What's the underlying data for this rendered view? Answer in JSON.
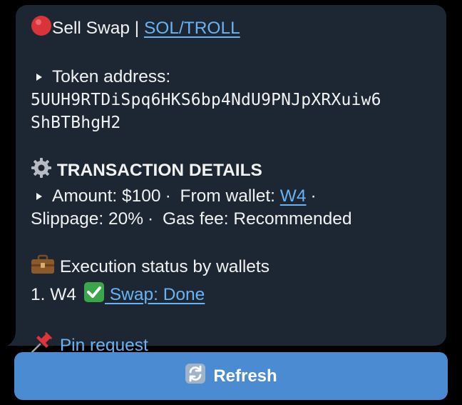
{
  "message": {
    "title_prefix": "Sell Swap | ",
    "pair_link": "SOL/TROLL",
    "token_label": "Token address:",
    "token_address_line1": "5UUH9RTDiSpq6HKS6bp4NdU9PNJpXRXuiw6",
    "token_address_line2": "ShBTBhgH2",
    "details_heading": "TRANSACTION DETAILS",
    "amount_text": "Amount: $100",
    "from_wallet_label": "From wallet: ",
    "from_wallet_link": "W4",
    "slippage_text": "Slippage: 20%",
    "gas_fee_text": "Gas fee: Recommended",
    "execution_heading": "Execution status by wallets",
    "execution_item_prefix": "1. W4",
    "execution_item_link": " Swap: Done",
    "pin_link": "Pin request",
    "separator": "·"
  },
  "button": {
    "refresh_label": "Refresh"
  },
  "colors": {
    "bubble_bg": "#1c2733",
    "link": "#6ab3f3",
    "button_bg": "#4a8bd1",
    "background": "#000000"
  },
  "icons": {
    "title": "red-circle-icon",
    "details": "gear-icon",
    "execution": "briefcase-icon",
    "status": "check-mark-icon",
    "pin": "pushpin-icon",
    "refresh": "refresh-icon"
  }
}
